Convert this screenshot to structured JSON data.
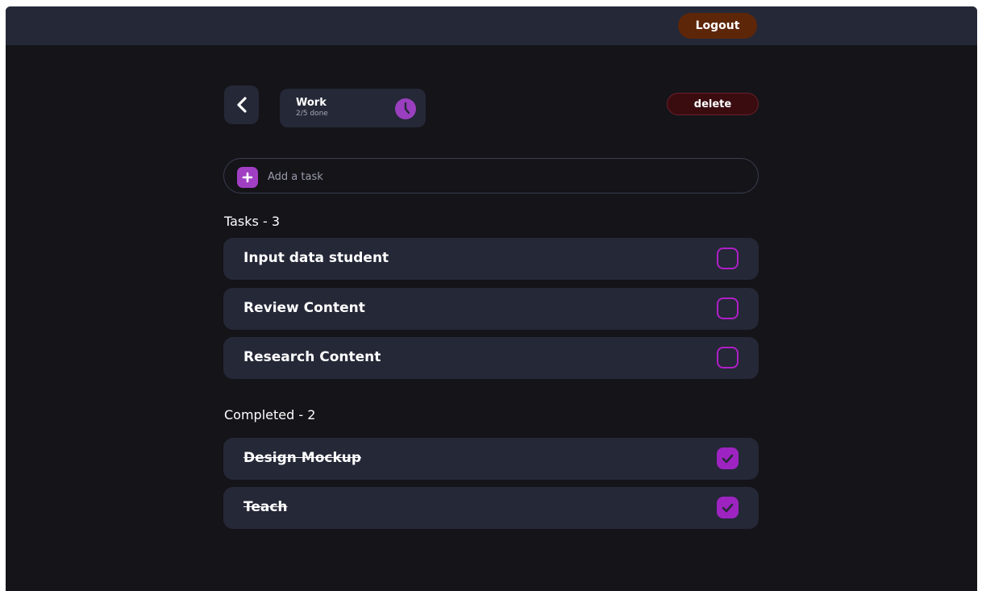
{
  "header": {
    "logout_label": "Logout"
  },
  "list": {
    "name": "Work",
    "progress": "2/5 done",
    "delete_label": "delete"
  },
  "add_task": {
    "placeholder": "Add a task"
  },
  "tasks_section": {
    "title": "Tasks - 3",
    "items": [
      {
        "label": "Input data student",
        "done": false
      },
      {
        "label": "Review Content",
        "done": false
      },
      {
        "label": "Research Content",
        "done": false
      }
    ]
  },
  "completed_section": {
    "title": "Completed - 2",
    "items": [
      {
        "label": "Design Mockup",
        "done": true
      },
      {
        "label": "Teach",
        "done": true
      }
    ]
  },
  "icons": {
    "back": "chevron-left-icon",
    "list": "clock-icon",
    "add": "plus-icon",
    "checked": "check-icon"
  },
  "colors": {
    "background": "#141419",
    "surface": "#252837",
    "accent": "#a13fc4",
    "logout": "#5e2608",
    "delete": "#3a0c10"
  }
}
